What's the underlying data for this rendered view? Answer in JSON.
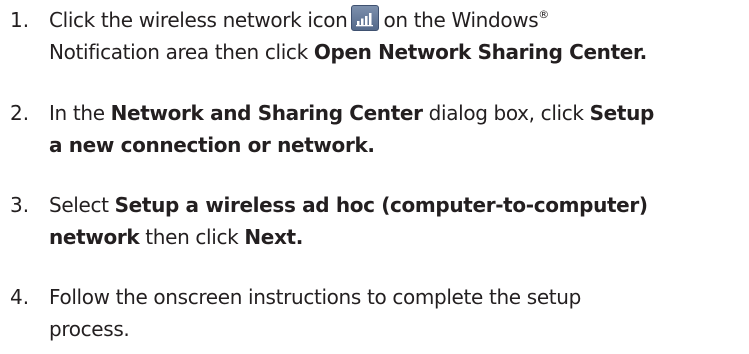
{
  "steps": [
    {
      "number": "1.",
      "line1": {
        "before_icon": "Click the wireless network icon",
        "after_icon": "on the Windows",
        "registered": "®"
      },
      "line2": {
        "text": "Notification area then click ",
        "bold": "Open Network Sharing Center."
      },
      "icon": "wireless-signal-bars-icon"
    },
    {
      "number": "2.",
      "line1": {
        "text_before": "In the ",
        "bold1": "Network and Sharing Center",
        "text_mid": " dialog box, click ",
        "bold2": "Setup"
      },
      "line2": {
        "bold": "a new connection or network."
      }
    },
    {
      "number": "3.",
      "line1": {
        "text_before": "Select ",
        "bold": "Setup a wireless ad hoc (computer-to-computer)"
      },
      "line2": {
        "bold1": "network",
        "text_mid": " then click ",
        "bold2": "Next."
      }
    },
    {
      "number": "4.",
      "line1": {
        "text": "Follow the onscreen instructions to complete the setup"
      },
      "line2": {
        "text": "process."
      }
    }
  ],
  "colors": {
    "text": "#231f20",
    "icon_background": "#6a7f9e",
    "icon_bars": "#ffffff"
  }
}
